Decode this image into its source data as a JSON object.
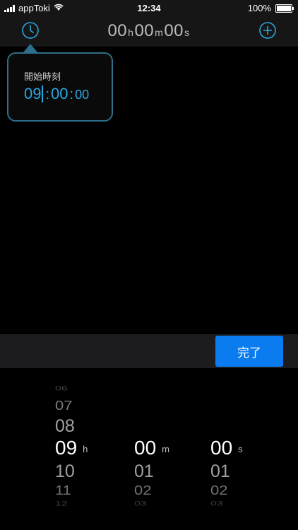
{
  "status_bar": {
    "carrier": "appToki",
    "time": "12:34",
    "battery": "100%"
  },
  "nav": {
    "title_h_num": "00",
    "title_h_unit": "h",
    "title_m_num": "00",
    "title_m_unit": "m",
    "title_s_num": "00",
    "title_s_unit": "s"
  },
  "popover": {
    "label": "開始時刻",
    "hour": "09",
    "sep1": ":",
    "minute": "00",
    "sep2": ":",
    "second": "00"
  },
  "toolbar": {
    "done_label": "完了"
  },
  "picker": {
    "hours": [
      "06",
      "07",
      "08",
      "09",
      "10",
      "11",
      "12"
    ],
    "minutes": [
      "00",
      "01",
      "02",
      "03"
    ],
    "seconds": [
      "00",
      "01",
      "02",
      "03"
    ],
    "unit_h": "h",
    "unit_m": "m",
    "unit_s": "s"
  },
  "colors": {
    "accent": "#2aa8e0",
    "button": "#0a7cf0",
    "bar": "#161616"
  }
}
